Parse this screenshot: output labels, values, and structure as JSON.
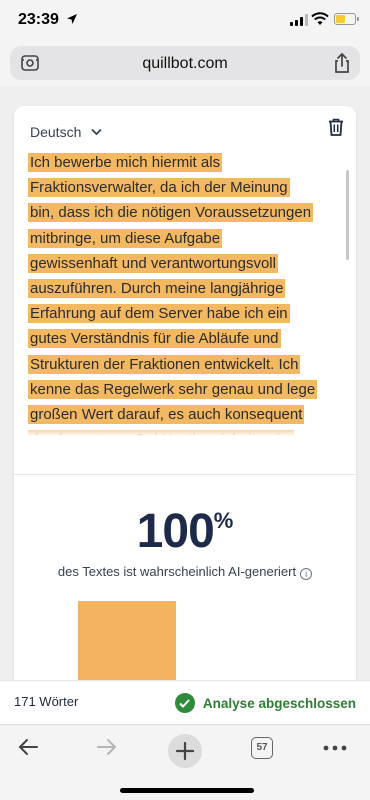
{
  "status_bar": {
    "time": "23:39",
    "battery_color": "#f5cd32"
  },
  "browser": {
    "url": "quillbot.com",
    "tab_count": "57"
  },
  "editor": {
    "language": "Deutsch",
    "text_lines": [
      "Ich bewerbe mich hiermit als",
      "Fraktionsverwalter, da ich der Meinung",
      "bin, dass ich die nötigen Voraussetzungen",
      "mitbringe, um diese Aufgabe",
      "gewissenhaft und verantwortungsvoll",
      "auszuführen. Durch meine langjährige",
      "Erfahrung auf dem Server habe ich ein",
      "gutes Verständnis für die Abläufe und",
      "Strukturen der Fraktionen entwickelt. Ich",
      "kenne das Regelwerk sehr genau und lege",
      "großen Wert darauf, es auch konsequent",
      "durchzusetzen. Bei Unstimmigkeiten ist"
    ],
    "highlight_color": "#f3b862"
  },
  "result": {
    "score": "100",
    "score_unit": "%",
    "caption": "des Textes ist wahrscheinlich AI-generiert",
    "bar_color": "#f4b35e",
    "bar_ai_fraction": 1.0
  },
  "footer": {
    "word_count": "171 Wörter",
    "analysis_status": "Analyse abgeschlossen",
    "status_color": "#2e8b3a"
  }
}
